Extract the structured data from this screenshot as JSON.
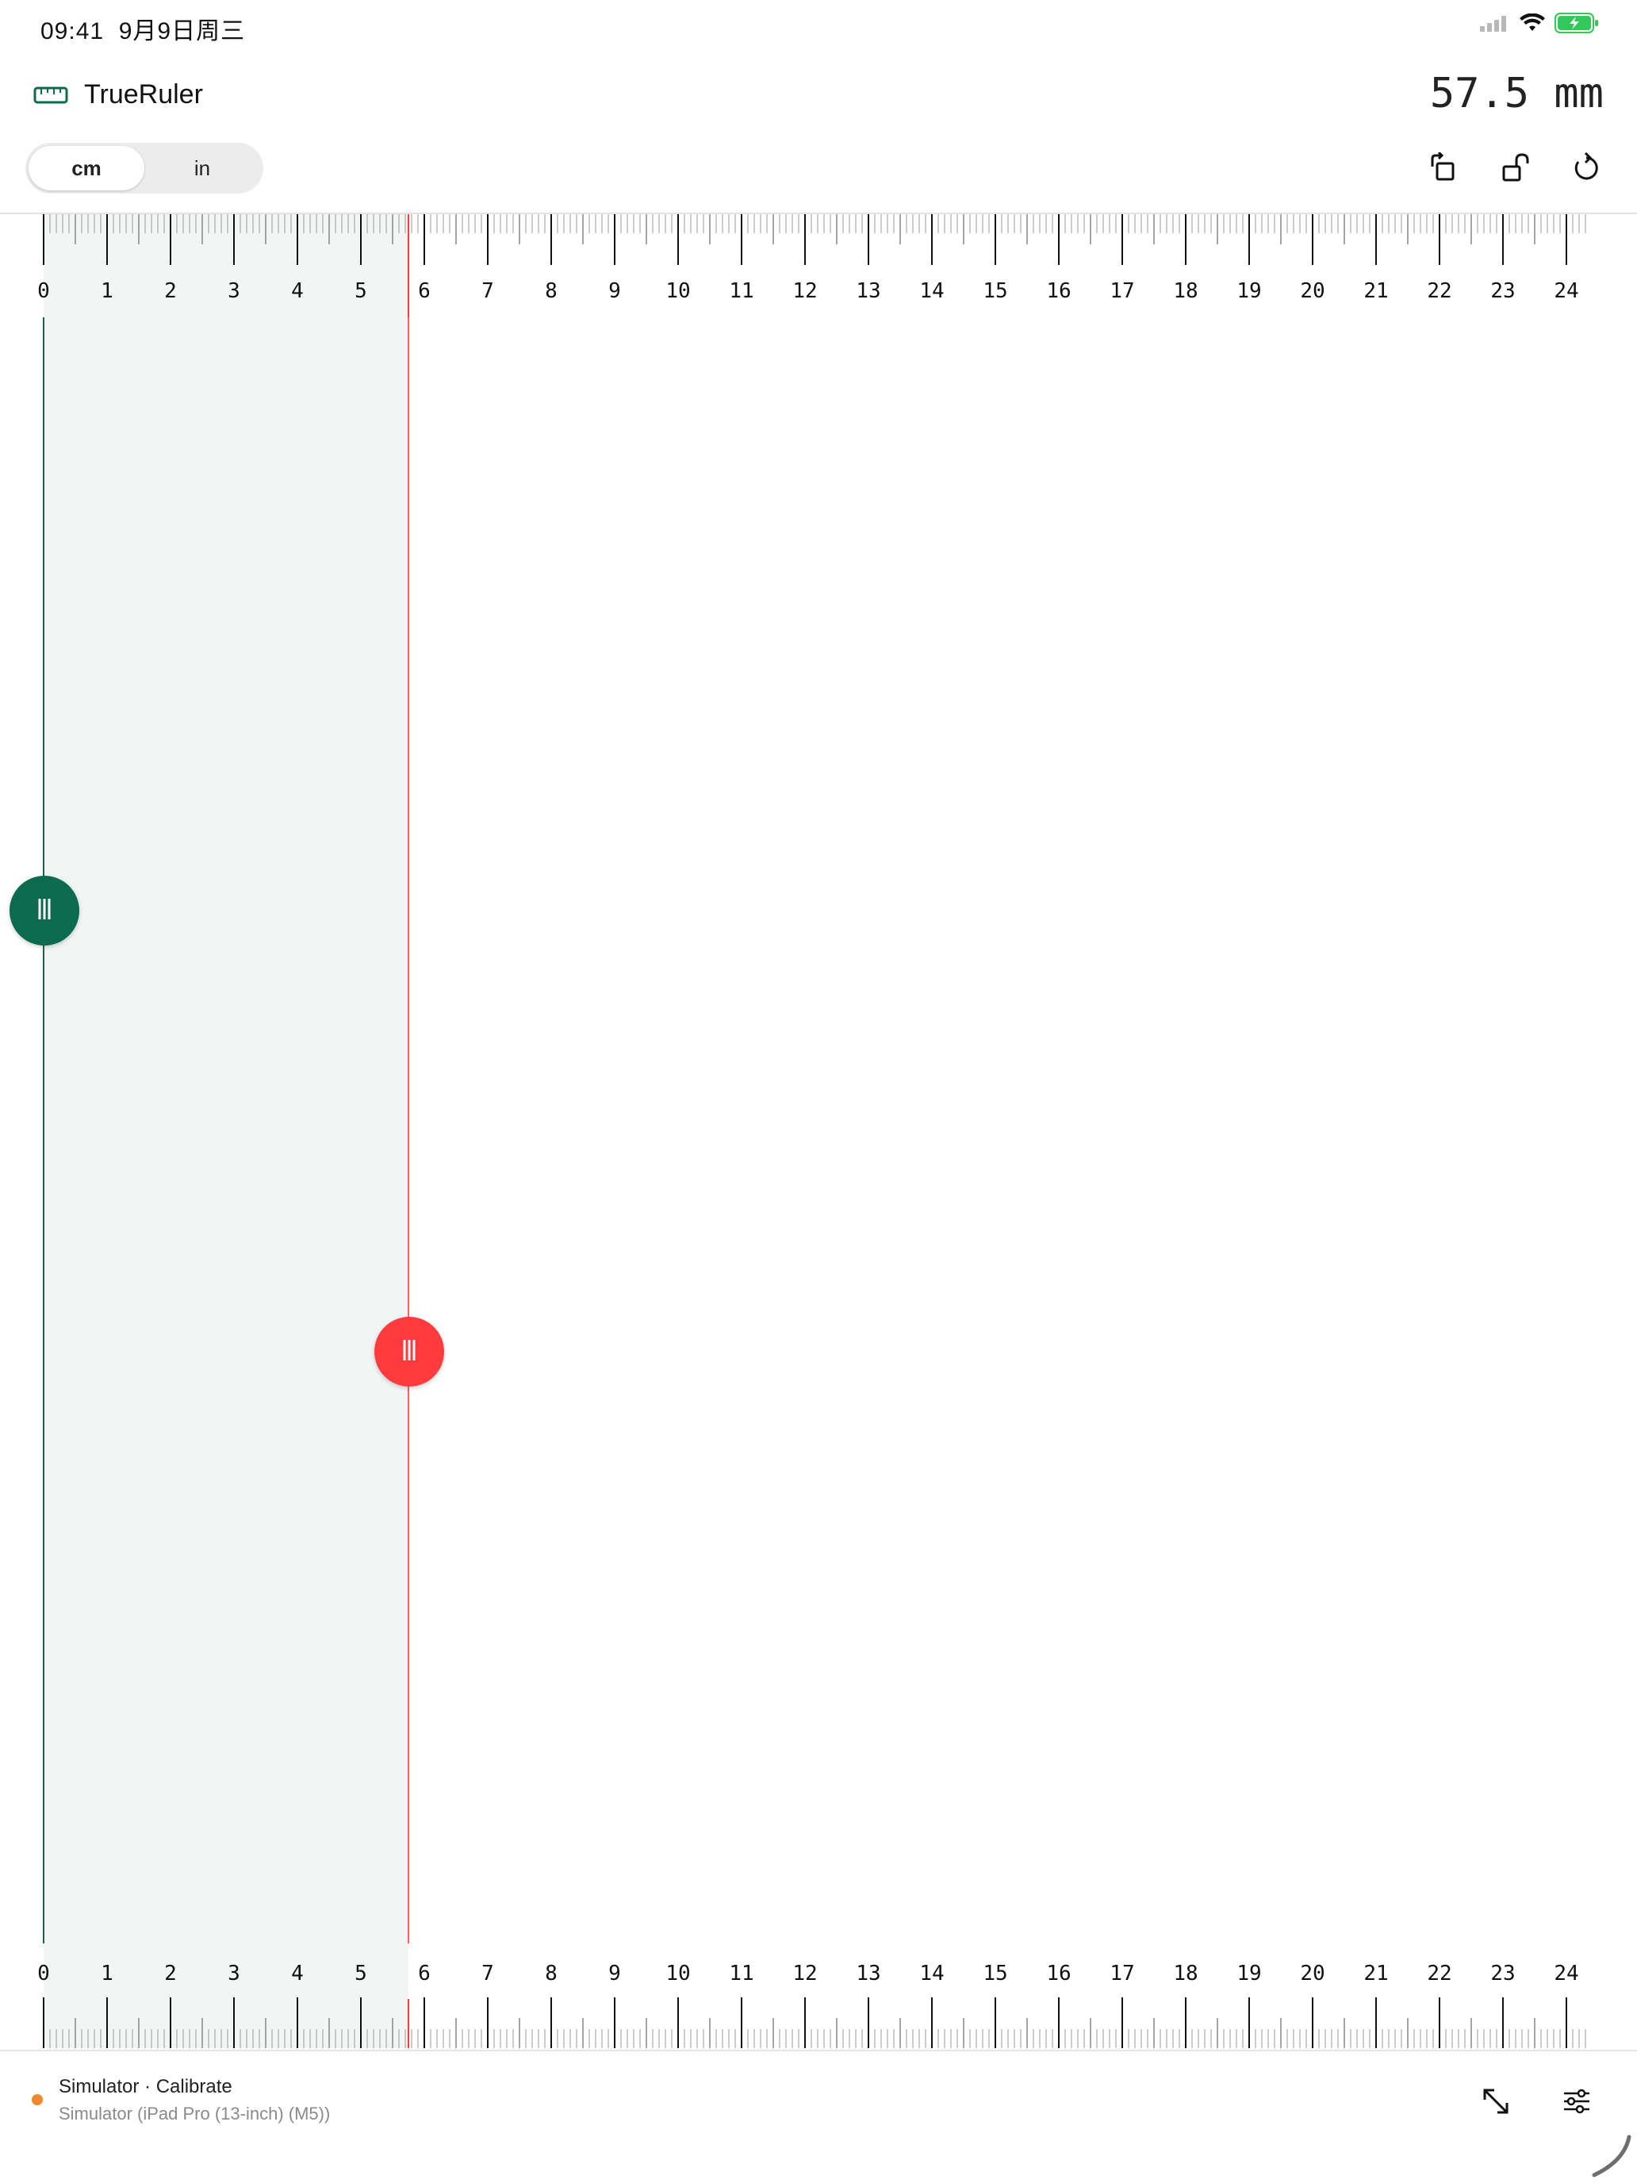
{
  "status_bar": {
    "time": "09:41",
    "date": "9月9日周三",
    "icons": [
      "cellular-signal-icon",
      "wifi-icon",
      "battery-charging-icon"
    ]
  },
  "header": {
    "app_icon": "ruler-icon",
    "title": "TrueRuler",
    "measurement": "57.5 mm",
    "unit_options": [
      {
        "label": "cm",
        "selected": true
      },
      {
        "label": "in",
        "selected": false
      }
    ],
    "tools": [
      "rotate-icon",
      "unlock-icon",
      "reset-icon"
    ]
  },
  "ruler": {
    "unit": "cm",
    "labels": [
      "0",
      "1",
      "2",
      "3",
      "4",
      "5",
      "6",
      "7",
      "8",
      "9",
      "10",
      "11",
      "12",
      "13",
      "14",
      "15",
      "16",
      "17",
      "18",
      "19",
      "20",
      "21",
      "22",
      "23",
      "24"
    ],
    "subdivisions_per_unit": 10,
    "start_marker_cm": 0,
    "end_marker_cm": 5.75
  },
  "colors": {
    "accent_green": "#0b6b4f",
    "accent_red": "#ff3b3d",
    "selection_fill": "#f1f6f4"
  },
  "footer": {
    "status_color": "#f0882e",
    "title": "Simulator · Calibrate",
    "subtitle": "Simulator (iPad Pro (13-inch) (M5))",
    "buttons": [
      "expand-icon",
      "sliders-icon"
    ]
  }
}
